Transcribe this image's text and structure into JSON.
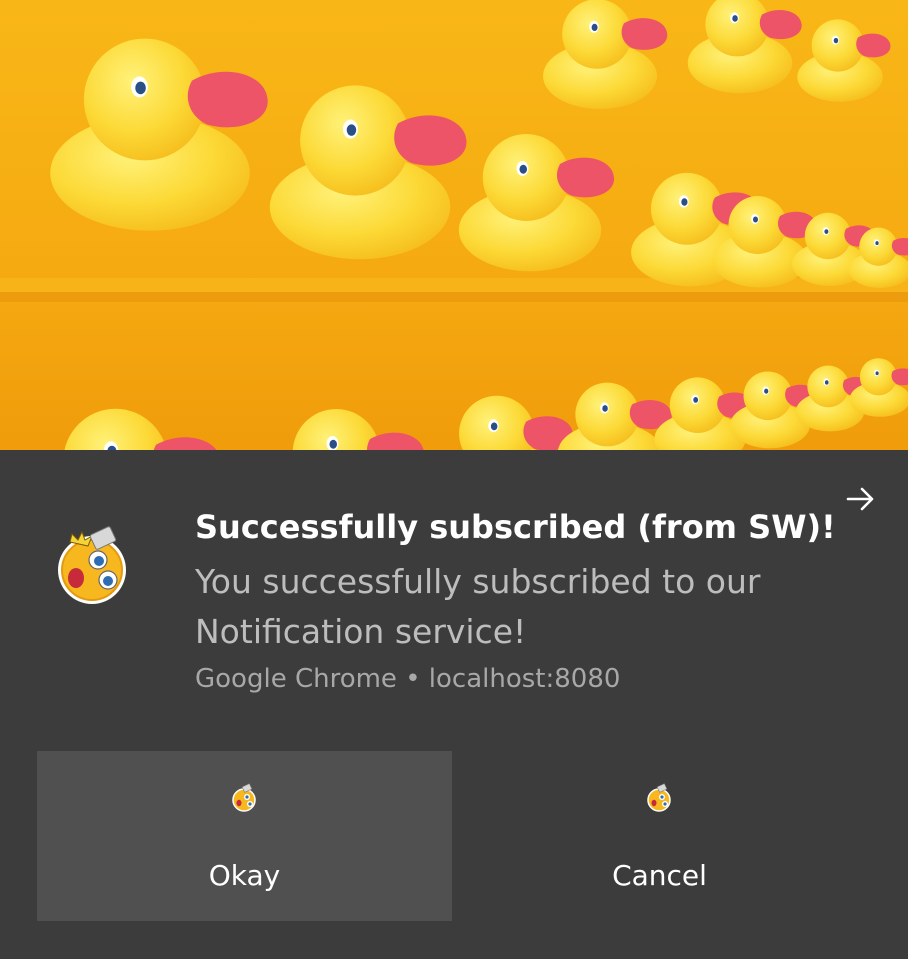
{
  "notification": {
    "hero_image": "rubber-ducks-photo",
    "app_icon": "emoji-face-icon",
    "title": "Successfully subscribed (from SW)!",
    "message": "You successfully subscribed to our Notification service!",
    "attribution": "Google Chrome • localhost:8080",
    "expand_icon": "arrow-right-icon",
    "actions": [
      {
        "label": "Okay",
        "icon": "emoji-face-icon"
      },
      {
        "label": "Cancel",
        "icon": "emoji-face-icon"
      }
    ]
  },
  "colors": {
    "background": "#3c3c3c",
    "primary_action_bg": "#505050",
    "title_text": "#ffffff",
    "message_text": "#bdbdbd",
    "hero_yellow": "#f4a912",
    "duck_yellow": "#fcd634",
    "duck_beak": "#f0566a"
  }
}
